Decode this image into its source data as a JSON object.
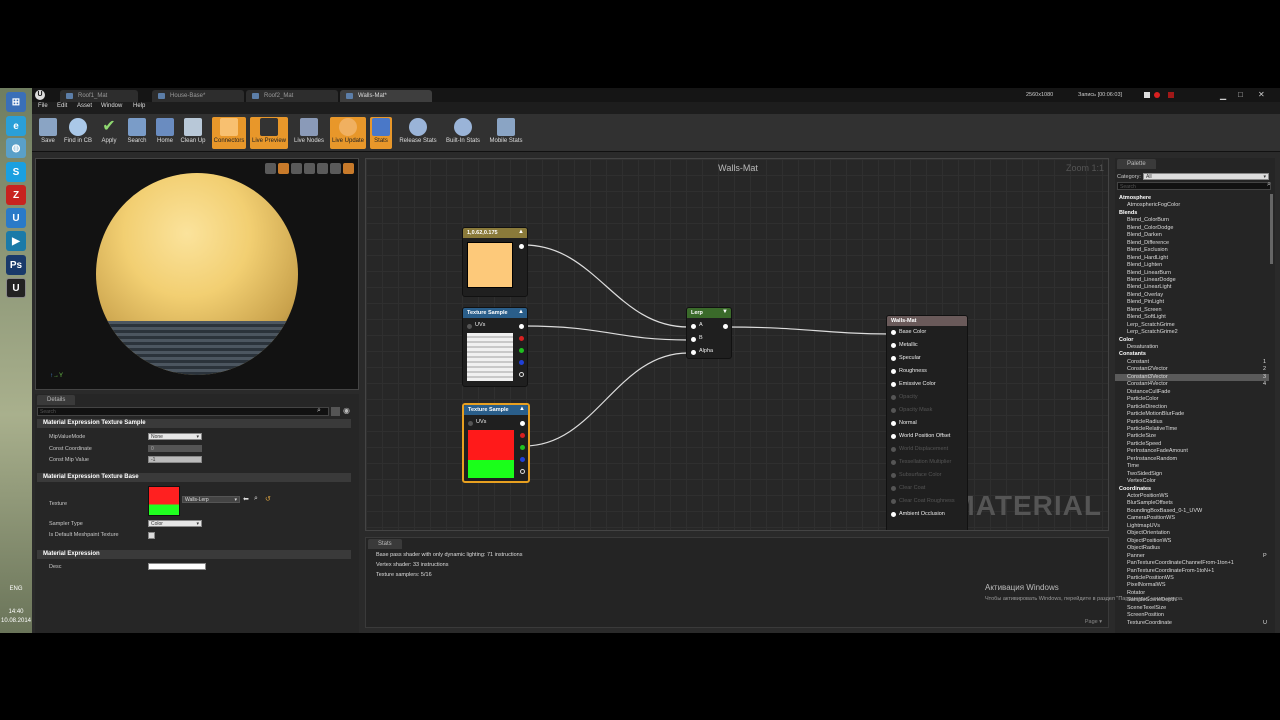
{
  "taskbar": {
    "clock_time": "14:40",
    "clock_date": "10.08.2014",
    "lang": "ENG"
  },
  "tabs": [
    {
      "label": "Roof1_Mat"
    },
    {
      "label": "House-Base*"
    },
    {
      "label": "Roof2_Mat"
    },
    {
      "label": "Walls-Mat*"
    }
  ],
  "recording": {
    "resolution": "2560x1080",
    "label": "Запись [00:06:03]"
  },
  "menu": [
    "File",
    "Edit",
    "Asset",
    "Window",
    "Help"
  ],
  "toolbar": [
    {
      "label": "Save",
      "icon": "save-icon"
    },
    {
      "label": "Find in CB",
      "icon": "find-icon"
    },
    {
      "label": "Apply",
      "icon": "apply-icon"
    },
    {
      "label": "Search",
      "icon": "search-icon"
    },
    {
      "label": "Home",
      "icon": "home-icon"
    },
    {
      "label": "Clean Up",
      "icon": "cleanup-icon"
    },
    {
      "label": "Connectors",
      "icon": "connectors-icon",
      "active": true
    },
    {
      "label": "Live Preview",
      "icon": "live-preview-icon",
      "active": true
    },
    {
      "label": "Live Nodes",
      "icon": "live-nodes-icon"
    },
    {
      "label": "Live Update",
      "icon": "live-update-icon",
      "active": true
    },
    {
      "label": "Stats",
      "icon": "stats-icon",
      "active": true
    },
    {
      "label": "Release Stats",
      "icon": "release-stats-icon"
    },
    {
      "label": "Built-In Stats",
      "icon": "builtin-stats-icon"
    },
    {
      "label": "Mobile Stats",
      "icon": "mobile-stats-icon"
    }
  ],
  "details": {
    "tab": "Details",
    "search_placeholder": "Search",
    "sections": {
      "s1": "Material Expression Texture Sample",
      "s2": "Material Expression Texture Base",
      "s3": "Material Expression"
    },
    "props": {
      "mip_mode": "MipValueMode",
      "mip_mode_val": "None",
      "const_coord": "Const Coordinate",
      "const_coord_val": "0",
      "const_mip": "Const Mip Value",
      "const_mip_val": "-1",
      "texture": "Texture",
      "texture_val": "Walls-Lerp",
      "sampler": "Sampler Type",
      "sampler_val": "Color",
      "default_mesh": "Is Default Meshpaint Texture",
      "desc": "Desc"
    }
  },
  "graph": {
    "title": "Walls-Mat",
    "zoom": "Zoom 1:1",
    "watermark": "MATERIAL",
    "const_node": {
      "title": "1,0.62,0.175",
      "color": "#fdc97a"
    },
    "tex1": {
      "title": "Texture Sample",
      "uvs": "UVs"
    },
    "tex2": {
      "title": "Texture Sample",
      "uvs": "UVs"
    },
    "lerp": {
      "title": "Lerp",
      "a": "A",
      "b": "B",
      "alpha": "Alpha"
    },
    "result": {
      "title": "Walls-Mat",
      "pins": [
        {
          "label": "Base Color",
          "active": true
        },
        {
          "label": "Metallic",
          "active": true
        },
        {
          "label": "Specular",
          "active": true
        },
        {
          "label": "Roughness",
          "active": true
        },
        {
          "label": "Emissive Color",
          "active": true
        },
        {
          "label": "Opacity",
          "active": false
        },
        {
          "label": "Opacity Mask",
          "active": false
        },
        {
          "label": "Normal",
          "active": true
        },
        {
          "label": "World Position Offset",
          "active": true
        },
        {
          "label": "World Displacement",
          "active": false
        },
        {
          "label": "Tessellation Multiplier",
          "active": false
        },
        {
          "label": "Subsurface Color",
          "active": false
        },
        {
          "label": "Clear Coat",
          "active": false
        },
        {
          "label": "Clear Coat Roughness",
          "active": false
        },
        {
          "label": "Ambient Occlusion",
          "active": true
        }
      ]
    }
  },
  "stats": {
    "tab": "Stats",
    "lines": [
      "Base pass shader with only dynamic lighting: 71 instructions",
      "Vertex shader: 33 instructions",
      "Texture samplers: 5/16"
    ],
    "page": "Page"
  },
  "palette": {
    "tab": "Palette",
    "category_label": "Category:",
    "category_value": "All",
    "search_placeholder": "Search",
    "rows": [
      {
        "t": "Atmosphere",
        "cat": true
      },
      {
        "t": "AtmosphericFogColor"
      },
      {
        "t": "Blends",
        "cat": true
      },
      {
        "t": "Blend_ColorBurn"
      },
      {
        "t": "Blend_ColorDodge"
      },
      {
        "t": "Blend_Darken"
      },
      {
        "t": "Blend_Difference"
      },
      {
        "t": "Blend_Exclusion"
      },
      {
        "t": "Blend_HardLight"
      },
      {
        "t": "Blend_Lighten"
      },
      {
        "t": "Blend_LinearBurn"
      },
      {
        "t": "Blend_LinearDodge"
      },
      {
        "t": "Blend_LinearLight"
      },
      {
        "t": "Blend_Overlay"
      },
      {
        "t": "Blend_PinLight"
      },
      {
        "t": "Blend_Screen"
      },
      {
        "t": "Blend_SoftLight"
      },
      {
        "t": "Lerp_ScratchGrime"
      },
      {
        "t": "Lerp_ScratchGrime2"
      },
      {
        "t": "Color",
        "cat": true
      },
      {
        "t": "Desaturation"
      },
      {
        "t": "Constants",
        "cat": true
      },
      {
        "t": "Constant",
        "key": "1"
      },
      {
        "t": "Constant2Vector",
        "key": "2"
      },
      {
        "t": "Constant3Vector",
        "key": "3",
        "sel": true
      },
      {
        "t": "Constant4Vector",
        "key": "4"
      },
      {
        "t": "DistanceCullFade"
      },
      {
        "t": "ParticleColor"
      },
      {
        "t": "ParticleDirection"
      },
      {
        "t": "ParticleMotionBlurFade"
      },
      {
        "t": "ParticleRadius"
      },
      {
        "t": "ParticleRelativeTime"
      },
      {
        "t": "ParticleSize"
      },
      {
        "t": "ParticleSpeed"
      },
      {
        "t": "PerInstanceFadeAmount"
      },
      {
        "t": "PerInstanceRandom"
      },
      {
        "t": "Time"
      },
      {
        "t": "TwoSidedSign"
      },
      {
        "t": "VertexColor"
      },
      {
        "t": "Coordinates",
        "cat": true
      },
      {
        "t": "ActorPositionWS"
      },
      {
        "t": "BlurSampleOffsets"
      },
      {
        "t": "BoundingBoxBased_0-1_UVW"
      },
      {
        "t": "CameraPositionWS"
      },
      {
        "t": "LightmapUVs"
      },
      {
        "t": "ObjectOrientation"
      },
      {
        "t": "ObjectPositionWS"
      },
      {
        "t": "ObjectRadius"
      },
      {
        "t": "Panner",
        "key": "P"
      },
      {
        "t": "PanTextureCoordinateChannelFrom-1ton+1"
      },
      {
        "t": "PanTextureCoordinateFrom-1toN+1"
      },
      {
        "t": "ParticlePositionWS"
      },
      {
        "t": "PixelNormalWS"
      },
      {
        "t": "Rotator"
      },
      {
        "t": "SampleSceneDepth"
      },
      {
        "t": "SceneTexelSize"
      },
      {
        "t": "ScreenPosition"
      },
      {
        "t": "TextureCoordinate",
        "key": "U"
      }
    ]
  },
  "activation": {
    "title": "Активация Windows",
    "sub": "Чтобы активировать Windows, перейдите в раздел \"Параметры\" компьютера."
  }
}
